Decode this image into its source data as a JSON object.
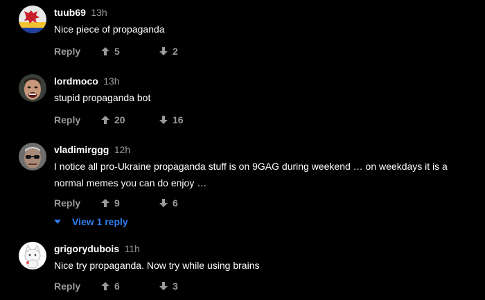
{
  "comments": [
    {
      "username": "tuub69",
      "time": "13h",
      "text": "Nice piece of propaganda",
      "reply_label": "Reply",
      "upvotes": "5",
      "downvotes": "2",
      "avatar": "flag-avatar"
    },
    {
      "username": "lordmoco",
      "time": "13h",
      "text": "stupid propaganda bot",
      "reply_label": "Reply",
      "upvotes": "20",
      "downvotes": "16",
      "avatar": "face-avatar"
    },
    {
      "username": "vladimirggg",
      "time": "12h",
      "text": "I notice all pro-Ukraine propaganda stuff is on 9GAG during weekend … on weekdays it is a normal memes you can do enjoy …",
      "reply_label": "Reply",
      "upvotes": "9",
      "downvotes": "6",
      "view_replies": "View 1 reply",
      "avatar": "sunglasses-face-avatar"
    },
    {
      "username": "grigorydubois",
      "time": "11h",
      "text": "Nice try propaganda. Now try while using brains",
      "reply_label": "Reply",
      "upvotes": "6",
      "downvotes": "3",
      "avatar": "cat-avatar"
    }
  ],
  "colors": {
    "background": "#000000",
    "text": "#ffffff",
    "muted": "#999999",
    "link": "#2f7ef3"
  },
  "icons": {
    "upvote": "arrow-up-icon",
    "downvote": "arrow-down-icon",
    "expand": "caret-down-icon"
  }
}
